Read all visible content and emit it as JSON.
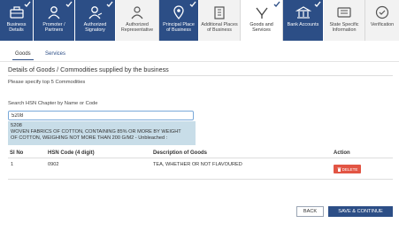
{
  "steps": [
    {
      "label": "Business Details",
      "icon": "briefcase-icon",
      "state": "done"
    },
    {
      "label": "Promoter / Partners",
      "icon": "users-icon",
      "state": "done"
    },
    {
      "label": "Authorized Signatory",
      "icon": "user-icon",
      "state": "done"
    },
    {
      "label": "Authorized Representative",
      "icon": "people-icon",
      "state": "plain"
    },
    {
      "label": "Principal Place of Business",
      "icon": "location-pin-icon",
      "state": "done"
    },
    {
      "label": "Additional Places of Business",
      "icon": "building-icon",
      "state": "plain"
    },
    {
      "label": "Goods and Services",
      "icon": "goods-icon",
      "state": "active"
    },
    {
      "label": "Bank Accounts",
      "icon": "bank-icon",
      "state": "done"
    },
    {
      "label": "State Specific Information",
      "icon": "info-card-icon",
      "state": "plain"
    },
    {
      "label": "Verification",
      "icon": "check-circle-icon",
      "state": "plain"
    }
  ],
  "subtabs": {
    "goods": "Goods",
    "services": "Services"
  },
  "heading": "Details of Goods / Commodities supplied by the business",
  "note": "Please specify top 5 Commodities",
  "search": {
    "label": "Search HSN Chapter by Name or Code",
    "value": "5208",
    "suggestion_code": "5208",
    "suggestion_desc_1": "WOVEN FABRICS OF COTTON, CONTAINING 85% OR MORE BY WEIGHT",
    "suggestion_desc_2": "OF COTTON, WEIGHING NOT MORE THAN 200 G/M2 - Unbleached :"
  },
  "table": {
    "headers": {
      "sl": "Sl No",
      "hsn": "HSN Code (4 digit)",
      "desc": "Description of Goods",
      "action": "Action"
    },
    "rows": [
      {
        "sl": "1",
        "hsn": "0902",
        "desc": "TEA, WHETHER OR NOT FLAVOURED",
        "action": "DELETE"
      }
    ]
  },
  "buttons": {
    "back": "BACK",
    "save": "SAVE & CONTINUE"
  },
  "colors": {
    "primary": "#2c4e86",
    "danger": "#e25544",
    "suggest_bg": "#c8dde8"
  }
}
